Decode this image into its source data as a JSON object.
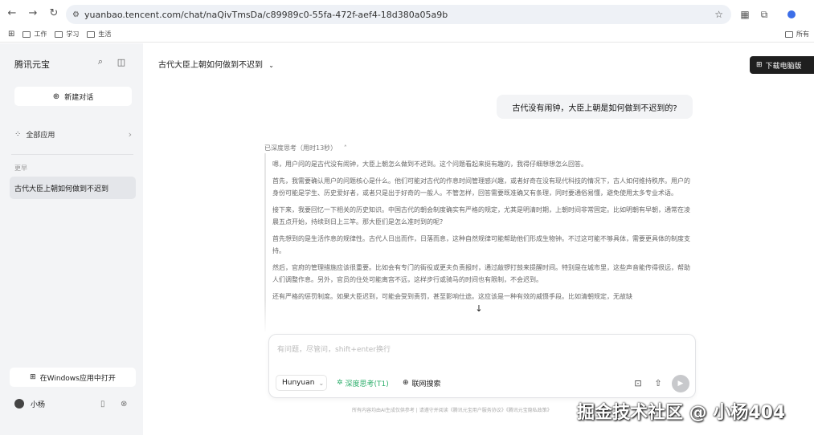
{
  "browser": {
    "url": "yuanbao.tencent.com/chat/naQivTmsDa/c89989c0-55fa-472f-aef4-18d380a05a9b",
    "bookmarks": [
      "工作",
      "学习",
      "生活"
    ],
    "bookmarks_right": "所有"
  },
  "sidebar": {
    "brand": "腾讯元宝",
    "new_chat": "新建对话",
    "all_apps": "全部应用",
    "section_label": "更早",
    "history": [
      "古代大臣上朝如何做到不迟到"
    ],
    "open_windows": "在Windows应用中打开",
    "user_name": "小杨"
  },
  "main": {
    "conversation_title": "古代大臣上朝如何做到不迟到",
    "download_label": "下载电脑版",
    "user_message": "古代没有闹钟，大臣上朝是如何做到不迟到的?",
    "thinking_header": "已深度思考（用时13秒）",
    "thinking_paragraphs": [
      "嗯，用户问的是古代没有闹钟，大臣上朝怎么做到不迟到。这个问题看起来挺有趣的，我得仔细想想怎么回答。",
      "首先，我需要确认用户的问题核心是什么。他们可能对古代的作息时间管理感兴趣，或者好奇在没有现代科技的情况下，古人如何维持秩序。用户的身份可能是学生、历史爱好者，或者只是出于好奇的一般人。不管怎样，回答需要既准确又有条理，同时要通俗易懂，避免使用太多专业术语。",
      "接下来，我要回忆一下相关的历史知识。中国古代的朝会制度确实有严格的规定，尤其是明清时期，上朝时间非常固定。比如明朝有早朝，通常在凌晨五点开始，持续到日上三竿。那大臣们是怎么准时到的呢?",
      "首先想到的是生活作息的规律性。古代人日出而作，日落而息，这种自然规律可能帮助他们形成生物钟。不过这可能不够具体，需要更具体的制度支持。",
      "然后，官府的管理措施应该很重要。比如会有专门的衙役或更夫负责报时，通过敲锣打鼓来提醒时间。特别是在城市里，这些声音能传得很远，帮助人们调整作息。另外，官员的住处可能离宫不远，这样步行或骑马的时间也有限制，不会迟到。",
      "还有严格的惩罚制度。如果大臣迟到，可能会受到责罚，甚至影响仕途。这应该是一种有效的威慑手段。比如清朝规定，无故缺"
    ],
    "input_placeholder": "有问题，尽管问，shift+enter换行",
    "model_name": "Hunyuan",
    "deep_think_label": "深度思考(T1)",
    "web_search_label": "联网搜索",
    "disclaimer": "所有内容均由AI生成仅供参考 | 请遵守并阅读《腾讯元宝用户服务协议》《腾讯元宝隐私政策》"
  },
  "watermark": "掘金技术社区 @ 小杨404",
  "colors": {
    "accent_green": "#2dae6b",
    "sidebar_bg": "#f3f4f6",
    "download_bg": "#1f1f1f"
  }
}
